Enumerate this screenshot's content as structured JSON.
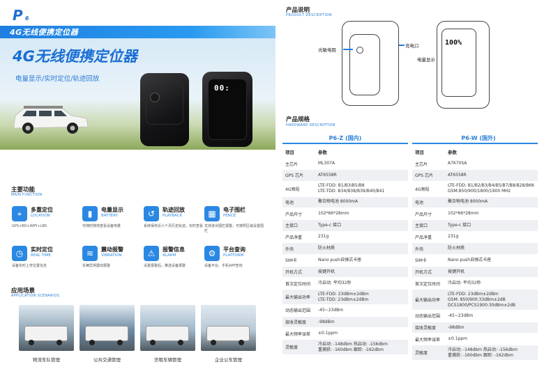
{
  "brand": {
    "logo": "P",
    "logo_sub": "6"
  },
  "banner": {
    "strip_text": "4G无线便携定位器",
    "title": "4G无线便携定位器",
    "subtitle": "电量显示/实时定位/轨迹回放"
  },
  "device_display": "00:",
  "features_section": {
    "title": "主要功能",
    "subtitle": "MAIN FUNCTION"
  },
  "features": [
    {
      "icon": "location-icon",
      "name": "多重定位",
      "en": "LOCATION",
      "desc": "GPS+BD+WIFI+LBS"
    },
    {
      "icon": "battery-icon",
      "name": "电量显示",
      "en": "BATTERY",
      "desc": "可随时随地查看设备电量"
    },
    {
      "icon": "playback-icon",
      "name": "轨迹回放",
      "en": "PLAYBACK",
      "desc": "系统保存近六个月历史轨迹，实时查看"
    },
    {
      "icon": "fence-icon",
      "name": "电子围栏",
      "en": "FENCE",
      "desc": "支持进出围栏报警，可按照区域设置围栏"
    },
    {
      "icon": "clock-icon",
      "name": "实时定位",
      "en": "REAL TIME",
      "desc": "设备实时上传位置信息"
    },
    {
      "icon": "vibration-icon",
      "name": "震动报警",
      "en": "VIBRATION",
      "desc": "车辆异常震动报警"
    },
    {
      "icon": "alarm-icon",
      "name": "报警信息",
      "en": "ALARM",
      "desc": "设置报警后，推送设备报警"
    },
    {
      "icon": "platform-icon",
      "name": "平台查询",
      "en": "PLATFORM",
      "desc": "设备平台、手机APP查询"
    }
  ],
  "scenes_section": {
    "title": "应用场景",
    "subtitle": "APPLICATION SCENARIOS"
  },
  "scenes": [
    {
      "label": "物流车队管理",
      "color": "#8fa7b8"
    },
    {
      "label": "公共交通管理",
      "color": "#6d8ba5"
    },
    {
      "label": "货租车辆管理",
      "color": "#9fb7c9"
    },
    {
      "label": "企业公车管理",
      "color": "#b9c9d6"
    }
  ],
  "product_desc": {
    "title": "产品说明",
    "subtitle": "PRODUCT DESCRIPTION",
    "label_sensor": "光敏电阻",
    "label_charge": "充电口",
    "label_battery": "电量显示",
    "display": "100%"
  },
  "specs": {
    "title": "产品规格",
    "subtitle": "HARDWARE DESCRIPTION",
    "left_title": "P6-Z (国内)",
    "right_title": "P6-W (国外)",
    "col_item": "项目",
    "col_param": "参数",
    "left_rows": [
      [
        "主芯片",
        "ML307A"
      ],
      [
        "GPS 芯片",
        "AT6558R"
      ],
      [
        "4G频段",
        "LTE-FDD: B1/B3/B5/B8\nLTE-TDD: B34/B38/B39/B40/B41"
      ],
      [
        "电池",
        "聚合物电池 8000mA"
      ],
      [
        "产品尺寸",
        "102*66*28mm"
      ],
      [
        "主接口",
        "Type-c 接口"
      ],
      [
        "产品净重",
        "231g"
      ],
      [
        "外壳",
        "防火材质"
      ],
      [
        "SIM卡",
        "Nano push自弹式卡座"
      ],
      [
        "开机方式",
        "按键开机"
      ],
      [
        "首次定位时间",
        "冷启动: 平均32秒"
      ],
      [
        "最大输出功率",
        "LTE-FDD: 23dBm±2dBm\nLTE-TDD: 23dBm±2dBm"
      ],
      [
        "动态输出范围",
        "-45~23dBm"
      ],
      [
        "接收灵敏度",
        "-98dBm"
      ],
      [
        "最大频率误差",
        "±0.1ppm"
      ],
      [
        "灵敏度",
        "冷启动: -148dbm  热启动: -156dbm\n重捕获: -160dbm 跟踪: -162dbm"
      ]
    ],
    "right_rows": [
      [
        "主芯片",
        "A7670SA"
      ],
      [
        "GPS 芯片",
        "AT6558R"
      ],
      [
        "4G频段",
        "LTE-FDD: B1/B2/B3/B4/B5/B7/B8/B28/B66\nGSM:850/900/1800/1900 MHz"
      ],
      [
        "电池",
        "聚合物电池 8000mA"
      ],
      [
        "产品尺寸",
        "102*66*28mm"
      ],
      [
        "主接口",
        "Type-c 接口"
      ],
      [
        "产品净重",
        "231g"
      ],
      [
        "外壳",
        "防火材质"
      ],
      [
        "SIM卡",
        "Nano push自弹式卡座"
      ],
      [
        "开机方式",
        "按键开机"
      ],
      [
        "首次定位时间",
        "冷启动: 平均32秒"
      ],
      [
        "最大输出功率",
        "LTE-FDD: 23dBm±2dBm\nGSM: 850/900:33dBm±2dB\nDCS1800/PCS1900:30dBm±2dB"
      ],
      [
        "动态输出范围",
        "-45~23dBm"
      ],
      [
        "接收灵敏度",
        "-98dBm"
      ],
      [
        "最大频率误差",
        "±0.1ppm"
      ],
      [
        "灵敏度",
        "冷启动: -148dbm  热启动: -156dbm\n重捕获: -160dbm 跟踪: -162dbm"
      ]
    ]
  }
}
